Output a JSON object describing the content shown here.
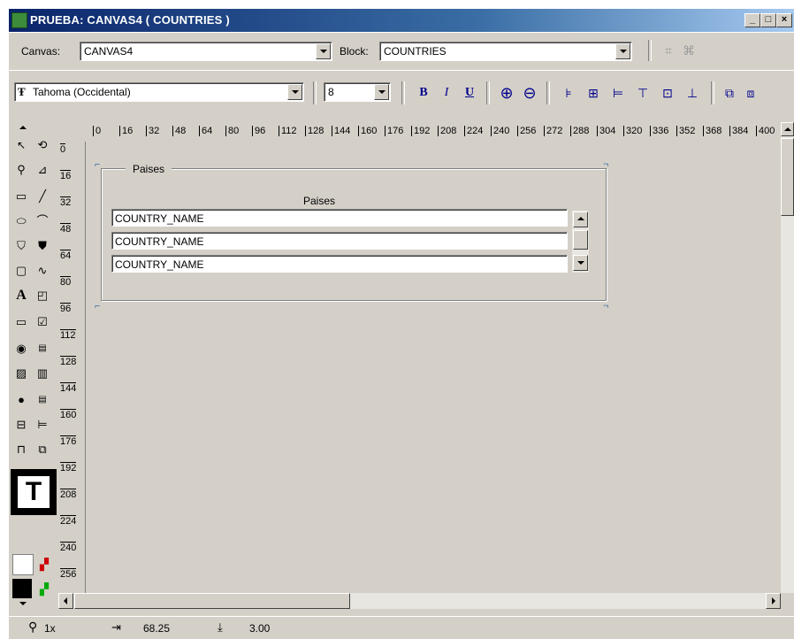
{
  "window": {
    "title": "PRUEBA: CANVAS4 ( COUNTRIES )",
    "minimize": "_",
    "restore": "□",
    "close": "×"
  },
  "toolbar": {
    "canvas_label": "Canvas:",
    "canvas_value": "CANVAS4",
    "block_label": "Block:",
    "block_value": "COUNTRIES",
    "font_value": "Tahoma (Occidental)",
    "font_icon": "truetype-icon",
    "size_value": "8",
    "bold": "B",
    "italic": "I",
    "underline": "U"
  },
  "ruler": {
    "horizontal": [
      "0",
      "16",
      "32",
      "48",
      "64",
      "80",
      "96",
      "112",
      "128",
      "144",
      "160",
      "176",
      "192",
      "208",
      "224",
      "240",
      "256",
      "272",
      "288",
      "304",
      "320",
      "336",
      "352",
      "368",
      "384",
      "400"
    ],
    "vertical": [
      "0",
      "16",
      "32",
      "48",
      "64",
      "80",
      "96",
      "112",
      "128",
      "144",
      "160",
      "176",
      "192",
      "208",
      "224",
      "240",
      "256"
    ]
  },
  "canvas": {
    "frame_title": "Paises",
    "column_header": "Paises",
    "rows": [
      "COUNTRY_NAME",
      "COUNTRY_NAME",
      "COUNTRY_NAME"
    ]
  },
  "tools": {
    "text_tool": "T",
    "text_label": "A"
  },
  "status": {
    "zoom": "1x",
    "x_value": "68.25",
    "y_value": "3.00"
  }
}
